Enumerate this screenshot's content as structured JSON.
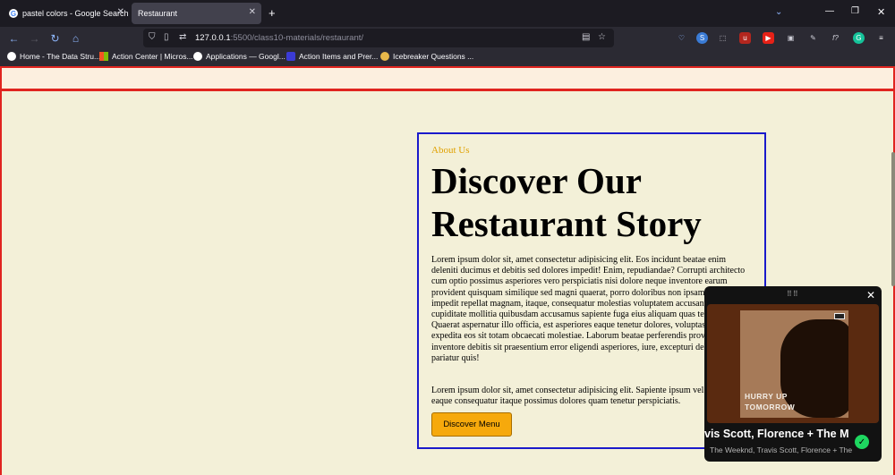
{
  "browser": {
    "tabs": [
      {
        "label": "pastel colors - Google Search",
        "active": false
      },
      {
        "label": "Restaurant",
        "active": true
      }
    ],
    "url_host": "127.0.0.1",
    "url_path": ":5500/class10-materials/restaurant/",
    "bookmarks": [
      {
        "label": "Home - The Data Stru...",
        "icon": "google-icon"
      },
      {
        "label": "Action Center | Micros...",
        "icon": "microsoft-icon"
      },
      {
        "label": "Applications — Googl...",
        "icon": "google-icon"
      },
      {
        "label": "Action Items and Prer...",
        "icon": "bookmark-p-icon"
      },
      {
        "label": "Icebreaker Questions ...",
        "icon": "bookmark-ice-icon"
      }
    ]
  },
  "about": {
    "label": "About Us",
    "heading": "Discover Our Restaurant Story",
    "paragraph1": "Lorem ipsum dolor sit, amet consectetur adipisicing elit. Eos incidunt beatae enim deleniti ducimus et debitis sed dolores impedit! Enim, repudiandae? Corrupti architecto cum optio possimus asperiores vero perspiciatis nisi dolore neque inventore earum provident quisquam similique sed magni quaerat, porro doloribus non ipsam? Distinctio impedit repellat magnam, itaque, consequatur molestias voluptatem accusantium cupiditate mollitia quibusdam accusamus sapiente fuga eius aliquam quas temporibus? Quaerat aspernatur illo officia, est asperiores eaque tenetur dolores, voluptas porro expedita eos sit totam obcaecati molestiae. Laborum beatae perferendis provident inventore debitis sit praesentium error eligendi asperiores, iure, excepturi deleniti pariatur quis!",
    "paragraph2": "Lorem ipsum dolor sit, amet consectetur adipisicing elit. Sapiente ipsum vel cupiditate eaque consequatur itaque possimus dolores quam tenetur perspiciatis.",
    "button": "Discover Menu"
  },
  "media_player": {
    "album_line1": "HURRY UP",
    "album_line2": "TOMORROW",
    "title": "vis Scott, Florence + The M",
    "artists": "The Weeknd, Travis Scott, Florence + The"
  }
}
